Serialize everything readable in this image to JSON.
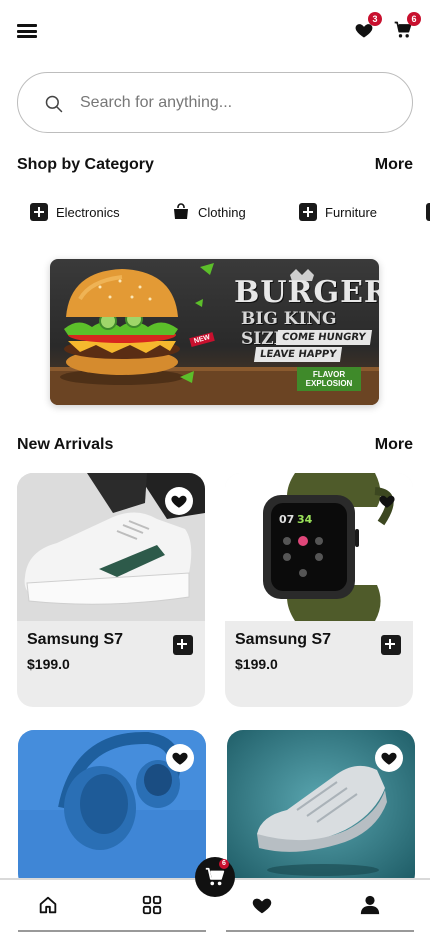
{
  "header": {
    "wishlist_count": "3",
    "cart_count": "6"
  },
  "search": {
    "placeholder": "Search for anything..."
  },
  "categories_section": {
    "title": "Shop by Category",
    "more": "More",
    "items": [
      {
        "label": "Electronics",
        "icon": "plus-box-icon"
      },
      {
        "label": "Clothing",
        "icon": "bag-icon"
      },
      {
        "label": "Furniture",
        "icon": "plus-box-icon"
      }
    ]
  },
  "banner": {
    "title": "BURGER",
    "subtitle": "BIG KING SIZE",
    "tag1": "COME HUNGRY",
    "tag2": "LEAVE HAPPY",
    "new_label": "NEW",
    "flavor": "FLAVOR EXPLOSION"
  },
  "new_arrivals": {
    "title": "New Arrivals",
    "more": "More",
    "products": [
      {
        "name": "Samsung S7",
        "price": "$199.0",
        "image": "white-sneaker"
      },
      {
        "name": "Samsung S7",
        "price": "$199.0",
        "image": "smartwatch"
      },
      {
        "name": "",
        "price": "",
        "image": "headphones"
      },
      {
        "name": "",
        "price": "",
        "image": "grey-sneaker"
      }
    ]
  },
  "bottom_nav": {
    "items": [
      "home-icon",
      "grid-icon",
      "heart-icon",
      "user-icon"
    ],
    "cart_badge": "6"
  },
  "colors": {
    "accent": "#c8102e",
    "card_bg": "#ececec",
    "dark": "#111111"
  }
}
